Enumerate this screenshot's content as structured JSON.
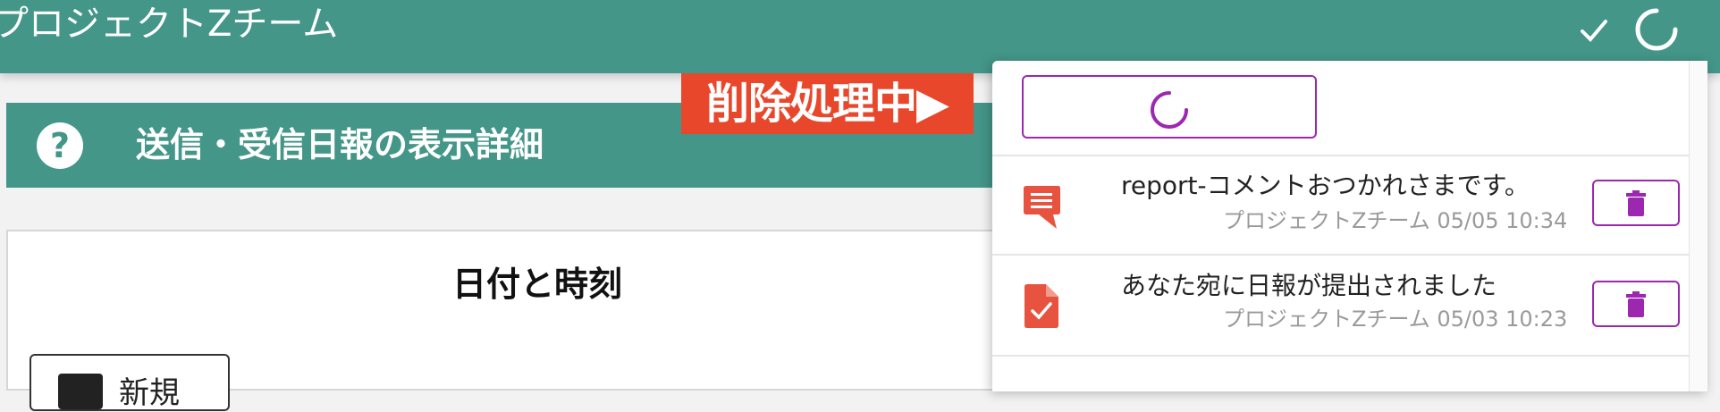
{
  "app": {
    "title": "プロジェクトZチーム",
    "icons": [
      "check-icon",
      "spinner-icon"
    ]
  },
  "banner": {
    "text": "削除処理中▶",
    "color": "#e8472b"
  },
  "section": {
    "title": "送信・受信日報の表示詳細",
    "icon": "help-icon"
  },
  "card": {
    "title": "日付と時刻",
    "button_label": "新規"
  },
  "notifications": {
    "load_icon": "spinner-icon",
    "items": [
      {
        "icon": "comment-icon",
        "message": "report-コメントおつかれさまです。",
        "meta": "プロジェクトZチーム 05/05 10:34",
        "delete_icon": "trash-icon"
      },
      {
        "icon": "document-check-icon",
        "message": "あなた宛に日報が提出されました",
        "meta": "プロジェクトZチーム 05/03 10:23",
        "delete_icon": "trash-icon"
      }
    ]
  },
  "colors": {
    "primary": "#439688",
    "accent": "#9c27b0",
    "alert": "#e8472b",
    "icon_red": "#e8533f"
  }
}
